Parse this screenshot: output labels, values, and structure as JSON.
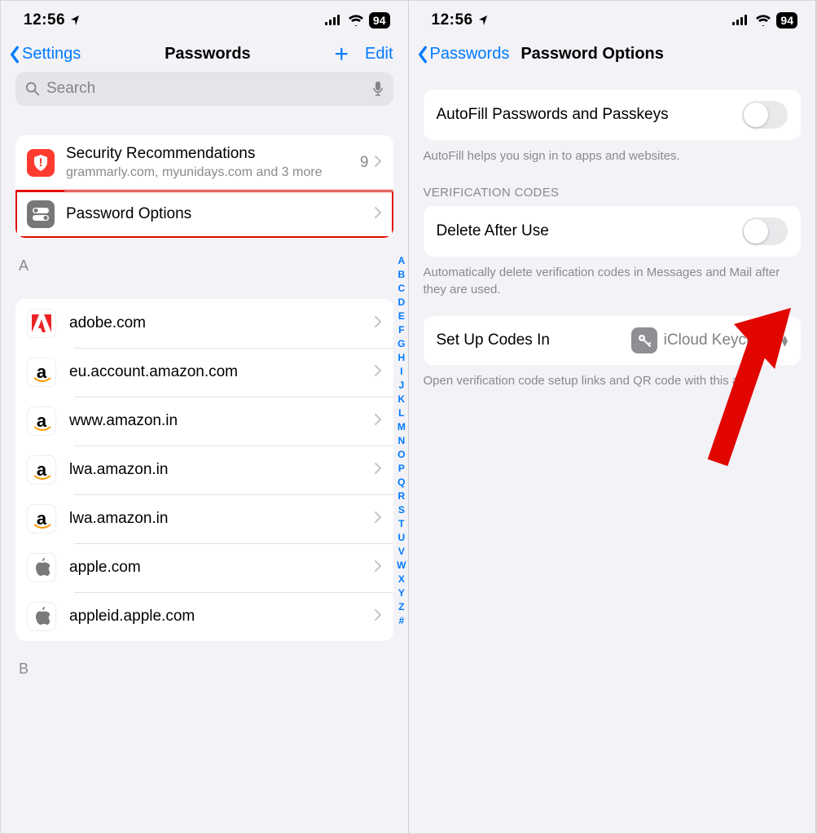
{
  "status": {
    "time": "12:56",
    "battery": "94"
  },
  "left": {
    "back": "Settings",
    "title": "Passwords",
    "edit": "Edit",
    "search_placeholder": "Search",
    "security": {
      "title": "Security Recommendations",
      "sub": "grammarly.com, myunidays.com and 3 more",
      "count": "9"
    },
    "options": "Password Options",
    "section_a": "A",
    "section_b": "B",
    "sites": [
      "adobe.com",
      "eu.account.amazon.com",
      "www.amazon.in",
      "lwa.amazon.in",
      "lwa.amazon.in",
      "apple.com",
      "appleid.apple.com"
    ],
    "index": [
      "A",
      "B",
      "C",
      "D",
      "E",
      "F",
      "G",
      "H",
      "I",
      "J",
      "K",
      "L",
      "M",
      "N",
      "O",
      "P",
      "Q",
      "R",
      "S",
      "T",
      "U",
      "V",
      "W",
      "X",
      "Y",
      "Z",
      "#"
    ]
  },
  "right": {
    "back": "Passwords",
    "title": "Password Options",
    "autofill_title": "AutoFill Passwords and Passkeys",
    "autofill_note": "AutoFill helps you sign in to apps and websites.",
    "verification_header": "VERIFICATION CODES",
    "delete_title": "Delete After Use",
    "delete_note": "Automatically delete verification codes in Messages and Mail after they are used.",
    "setup_label": "Set Up Codes In",
    "setup_value": "iCloud Keychain",
    "setup_note": "Open verification code setup links and QR code with this app."
  }
}
